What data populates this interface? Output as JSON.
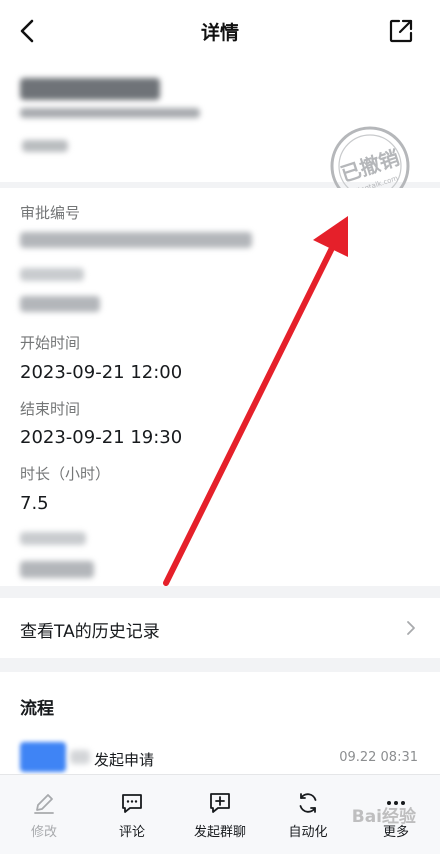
{
  "nav": {
    "title": "详情"
  },
  "header": {},
  "stamp": {
    "text": "已撤销",
    "domain": "dingtalk.com"
  },
  "details": {
    "approval_no_label": "审批编号",
    "start_label": "开始时间",
    "start_value": "2023-09-21 12:00",
    "end_label": "结束时间",
    "end_value": "2023-09-21 19:30",
    "duration_label": "时长（小时）",
    "duration_value": "7.5"
  },
  "history": {
    "label": "查看TA的历史记录"
  },
  "flow": {
    "title": "流程",
    "step_text": "发起申请",
    "step_time": "09.22 08:31"
  },
  "toolbar": {
    "items": [
      {
        "label": "修改",
        "icon": "edit-icon"
      },
      {
        "label": "评论",
        "icon": "comment-icon"
      },
      {
        "label": "发起群聊",
        "icon": "group-chat-icon"
      },
      {
        "label": "自动化",
        "icon": "automation-icon"
      },
      {
        "label": "更多",
        "icon": "more-icon"
      }
    ]
  },
  "watermark": {
    "text": "Bai经验"
  },
  "colors": {
    "accent_red": "#e5202a",
    "stamp_gray": "#b5b7ba",
    "blue_tag": "#3f84f5"
  }
}
